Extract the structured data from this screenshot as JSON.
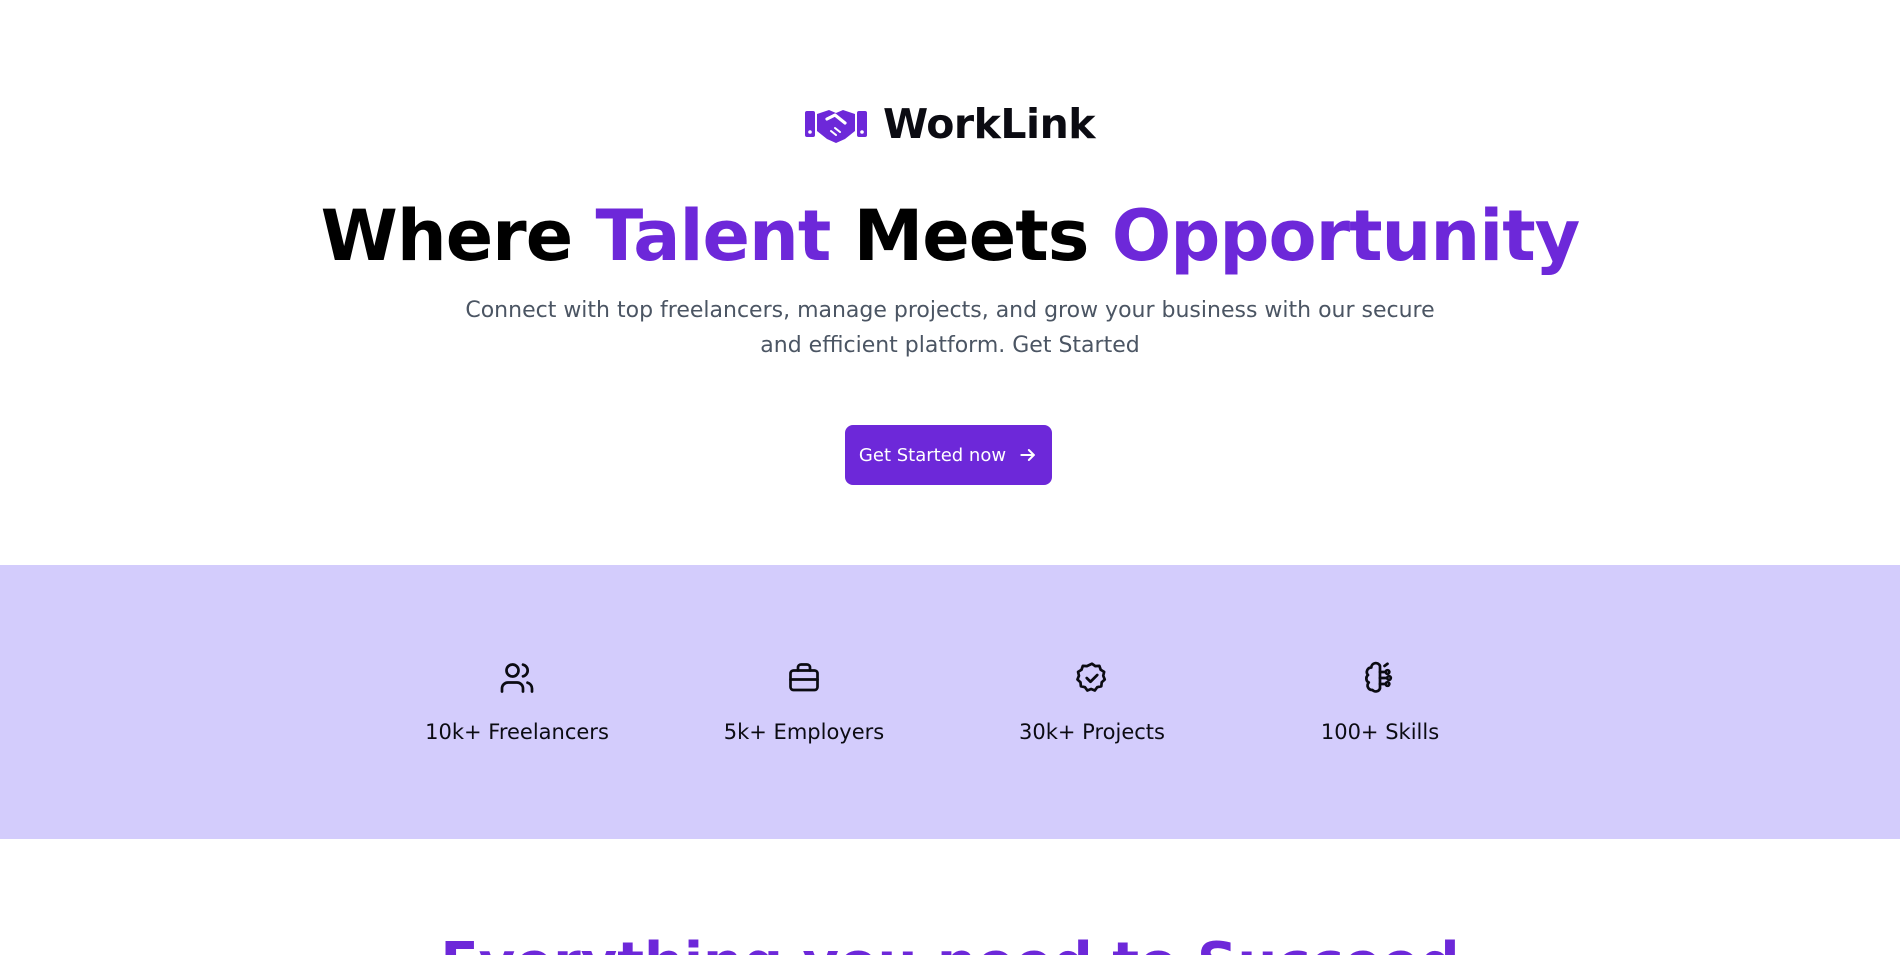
{
  "brand": {
    "name": "WorkLink",
    "logo_icon": "handshake-icon",
    "accent_color": "#6d28d9"
  },
  "hero": {
    "headline_part1": "Where ",
    "headline_accent1": "Talent",
    "headline_part2": " Meets ",
    "headline_accent2": "Opportunity",
    "subtext": "Connect with top freelancers, manage projects, and grow your business with our secure and efficient platform. Get Started",
    "cta_label": "Get Started now",
    "cta_icon": "arrow-right-icon"
  },
  "stats": {
    "background": "#d3ccfc",
    "items": [
      {
        "icon": "users-icon",
        "label": "10k+ Freelancers"
      },
      {
        "icon": "briefcase-icon",
        "label": "5k+ Employers"
      },
      {
        "icon": "badge-check-icon",
        "label": "30k+ Projects"
      },
      {
        "icon": "brain-icon",
        "label": "100+ Skills"
      }
    ]
  },
  "next_section": {
    "heading": "Everything you need to Succeed"
  }
}
